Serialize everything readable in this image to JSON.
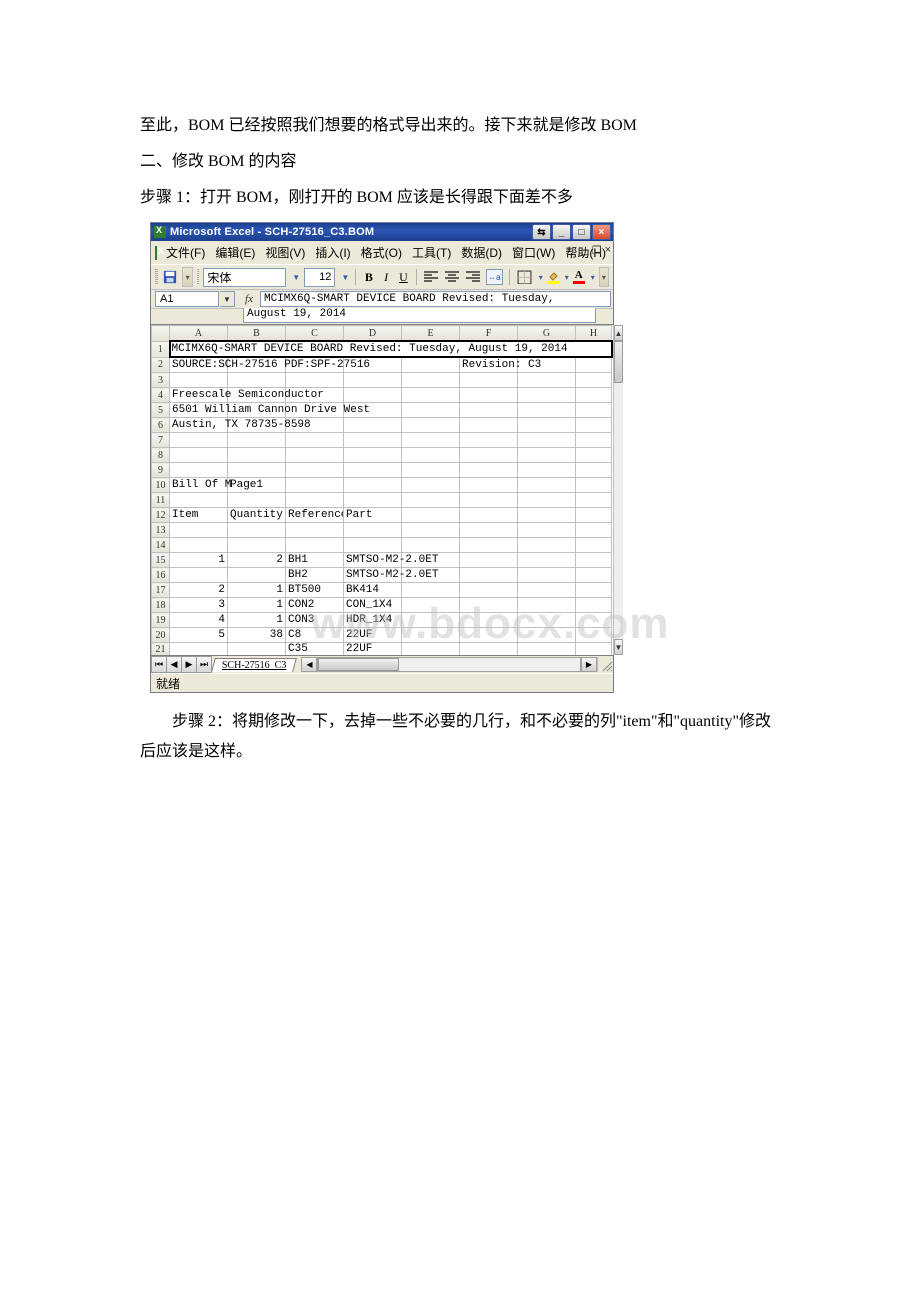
{
  "doc": {
    "p1": "至此，BOM 已经按照我们想要的格式导出来的。接下来就是修改 BOM",
    "p2": "二、修改 BOM 的内容",
    "p3": "步骤 1：打开 BOM，刚打开的 BOM 应该是长得跟下面差不多",
    "p4": "步骤 2：将期修改一下，去掉一些不必要的几行，和不必要的列\"item\"和\"quantity\"修改后应该是这样。"
  },
  "excel": {
    "title": "Microsoft Excel - SCH-27516_C3.BOM",
    "menu": {
      "file": "文件(F)",
      "edit": "编辑(E)",
      "view": "视图(V)",
      "insert": "插入(I)",
      "format": "格式(O)",
      "tools": "工具(T)",
      "data": "数据(D)",
      "window": "窗口(W)",
      "help": "帮助(H)"
    },
    "toolbar": {
      "font": "宋体",
      "size": "12",
      "color_fill": "#ffff00",
      "color_font": "#ff0000"
    },
    "namebox": "A1",
    "formula_line1": "MCIMX6Q-SMART DEVICE BOARD  Revised: Tuesday,",
    "formula_line2": "August 19, 2014",
    "columns": [
      "A",
      "B",
      "C",
      "D",
      "E",
      "F",
      "G",
      "H"
    ],
    "rows": [
      {
        "n": "1",
        "a": "MCIMX6Q-SMART DEVICE BOARD  Revised: Tuesday, August 19, 2014",
        "span": 8
      },
      {
        "n": "2",
        "a": "SOURCE:SCH-27516 PDF:SPF-27516",
        "f": "Revision: C3"
      },
      {
        "n": "3"
      },
      {
        "n": "4",
        "a": "Freescale Semiconductor"
      },
      {
        "n": "5",
        "a": "6501 William Cannon Drive West"
      },
      {
        "n": "6",
        "a": "Austin, TX 78735-8598"
      },
      {
        "n": "7"
      },
      {
        "n": "8"
      },
      {
        "n": "9"
      },
      {
        "n": "10",
        "a": "Bill Of M",
        "b": "Page1"
      },
      {
        "n": "11"
      },
      {
        "n": "12",
        "a": "Item",
        "b": "Quantity",
        "c": "Reference",
        "d": "Part"
      },
      {
        "n": "13"
      },
      {
        "n": "14"
      },
      {
        "n": "15",
        "a": "1",
        "b": "2",
        "c": "BH1",
        "d": "SMTSO-M2-2.0ET"
      },
      {
        "n": "16",
        "c": "BH2",
        "d": "SMTSO-M2-2.0ET"
      },
      {
        "n": "17",
        "a": "2",
        "b": "1",
        "c": "BT500",
        "d": "BK414"
      },
      {
        "n": "18",
        "a": "3",
        "b": "1",
        "c": "CON2",
        "d": "CON_1X4"
      },
      {
        "n": "19",
        "a": "4",
        "b": "1",
        "c": "CON3",
        "d": "HDR_1X4"
      },
      {
        "n": "20",
        "a": "5",
        "b": "38",
        "c": "C8",
        "d": "22UF"
      },
      {
        "n": "21",
        "c": "C35",
        "d": "22UF"
      }
    ],
    "sheet_tab": "SCH-27516_C3",
    "status": "就绪",
    "watermark": "www.bdocx.com"
  }
}
